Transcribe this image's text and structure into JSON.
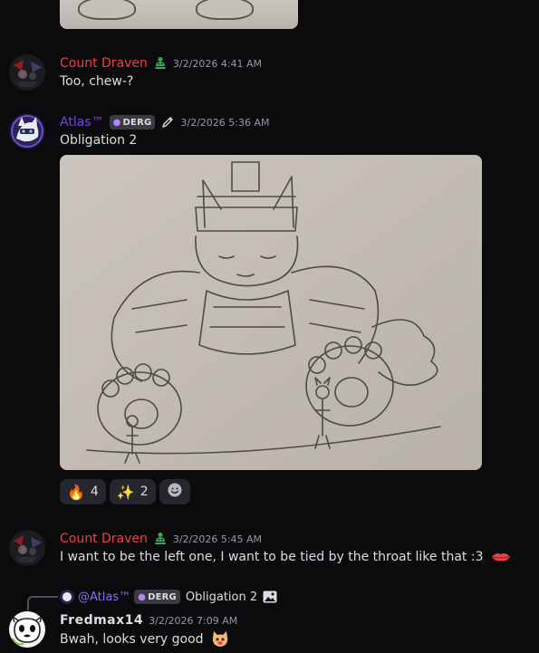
{
  "colors": {
    "count_draven": "#f23f42",
    "atlas": "#7b3ff2",
    "fredmax": "#dbdee1",
    "timestamp": "#949ba4",
    "reply_mention": "#8b6df2",
    "badge_accent": "#b083ff"
  },
  "messages": [
    {
      "username": "Count Draven",
      "role_icon": "green-android-icon",
      "timestamp": "3/2/2026 4:41 AM",
      "text": "Too, chew-?"
    },
    {
      "username": "Atlas™",
      "badge": "DERG",
      "badge_icon": "flame-icon",
      "extra_icon": "pen-icon",
      "timestamp": "3/2/2026 5:36 AM",
      "text": "Obligation 2",
      "attachment_kind": "pencil-sketch-image"
    },
    {
      "username": "Count Draven",
      "role_icon": "green-android-icon",
      "timestamp": "3/2/2026 5:45 AM",
      "text": "I want to be the left one, I want to be tied by the throat like that :3",
      "trailing_emoji": "lips-emoji"
    },
    {
      "username": "Fredmax14",
      "timestamp": "3/2/2026 7:09 AM",
      "text": "Bwah, looks very good",
      "trailing_emoji": "cat-face-emoji"
    }
  ],
  "reply": {
    "mention": "@Atlas™",
    "badge": "DERG",
    "text": "Obligation 2",
    "icon": "image-icon"
  },
  "reactions": [
    {
      "emoji": "🔥",
      "name": "fire",
      "count": "4"
    },
    {
      "emoji": "✨",
      "name": "sparkles",
      "count": "2"
    }
  ],
  "add_reaction_icon": "add-reaction-icon"
}
